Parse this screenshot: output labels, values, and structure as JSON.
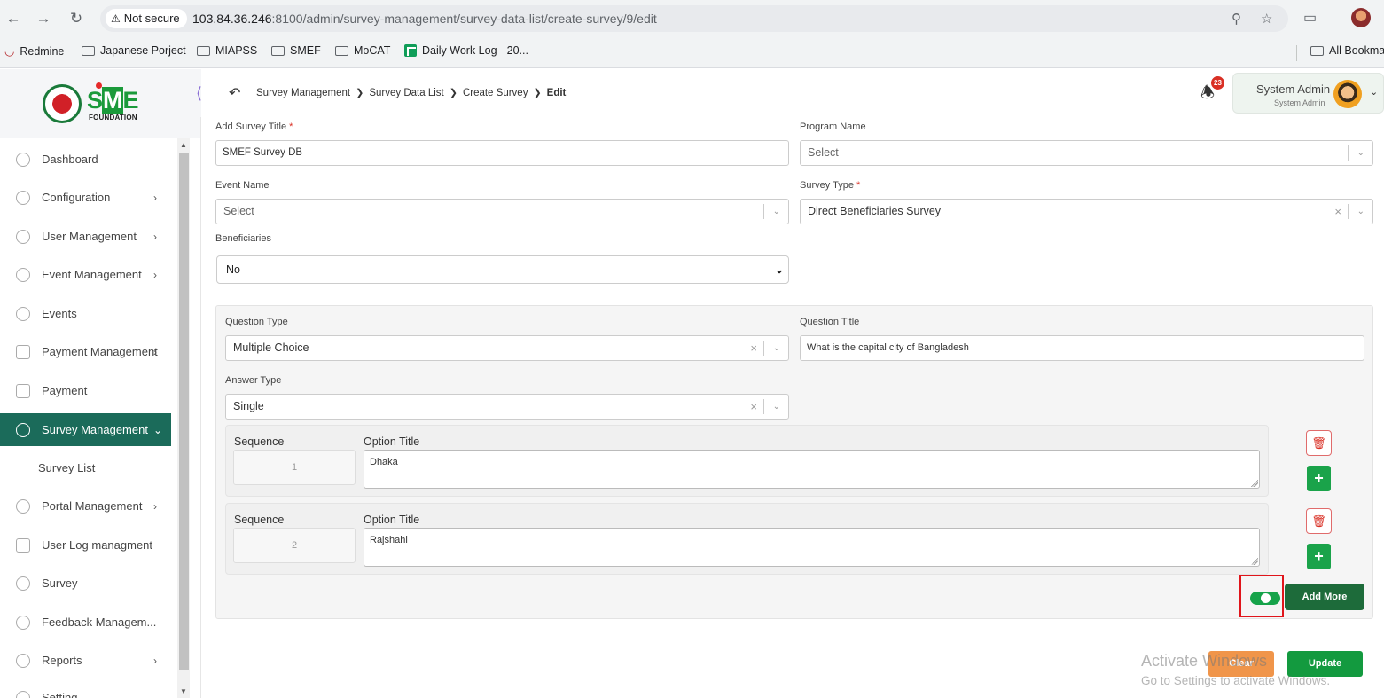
{
  "browser": {
    "security_label": "Not secure",
    "url_host": "103.84.36.246",
    "url_rest": ":8100/admin/survey-management/survey-data-list/create-survey/9/edit",
    "bookmarks": [
      "Redmine",
      "Japanese Porject",
      "MIAPSS",
      "SMEF",
      "MoCAT",
      "Daily Work Log - 20...",
      "All Bookma"
    ]
  },
  "brand": {
    "logo_text_s": "S",
    "logo_text_m": "M",
    "logo_text_e": "E",
    "logo_sub": "FOUNDATION"
  },
  "breadcrumb": [
    "Survey Management",
    "Survey Data List",
    "Create Survey",
    "Edit"
  ],
  "notifications": {
    "count": "23"
  },
  "user": {
    "name": "System Admin",
    "role": "System Admin"
  },
  "sidebar": {
    "items": [
      {
        "label": "Dashboard",
        "has_chevron": false
      },
      {
        "label": "Configuration",
        "has_chevron": true
      },
      {
        "label": "User Management",
        "has_chevron": true
      },
      {
        "label": "Event Management",
        "has_chevron": true
      },
      {
        "label": "Events",
        "has_chevron": false
      },
      {
        "label": "Payment Management",
        "has_chevron": true
      },
      {
        "label": "Payment",
        "has_chevron": false
      },
      {
        "label": "Survey Management",
        "has_chevron": true,
        "active": true
      },
      {
        "label": "Survey List",
        "sub": true
      },
      {
        "label": "Portal Management",
        "has_chevron": true
      },
      {
        "label": "User Log managment",
        "has_chevron": false
      },
      {
        "label": "Survey",
        "has_chevron": false
      },
      {
        "label": "Feedback Managem...",
        "has_chevron": false
      },
      {
        "label": "Reports",
        "has_chevron": true
      },
      {
        "label": "Setting",
        "has_chevron": false
      }
    ]
  },
  "form": {
    "survey_title_label": "Add Survey Title",
    "survey_title_value": "SMEF Survey DB",
    "program_label": "Program Name",
    "program_placeholder": "Select",
    "event_label": "Event Name",
    "event_placeholder": "Select",
    "survey_type_label": "Survey Type",
    "survey_type_value": "Direct Beneficiaries Survey",
    "beneficiaries_label": "Beneficiaries",
    "beneficiaries_value": "No",
    "required_mark": "*"
  },
  "question": {
    "type_label": "Question Type",
    "type_value": "Multiple Choice",
    "title_label": "Question Title",
    "title_value": "What is the capital city of Bangladesh",
    "answer_type_label": "Answer Type",
    "answer_type_value": "Single",
    "options": [
      {
        "sequence_label": "Sequence",
        "sequence": "1",
        "title_label": "Option Title",
        "title": "Dhaka"
      },
      {
        "sequence_label": "Sequence",
        "sequence": "2",
        "title_label": "Option Title",
        "title": "Rajshahi"
      }
    ],
    "toggle_on": true,
    "add_more_label": "Add More"
  },
  "actions": {
    "clear_label": "Clear",
    "update_label": "Update"
  },
  "watermark": {
    "line1": "Activate Windows",
    "line2": "Go to Settings to activate Windows."
  },
  "colors": {
    "sidebar_active": "#1b6b5a",
    "primary_green": "#139a3f",
    "clear_orange": "#f0954a",
    "danger": "#d93025"
  }
}
